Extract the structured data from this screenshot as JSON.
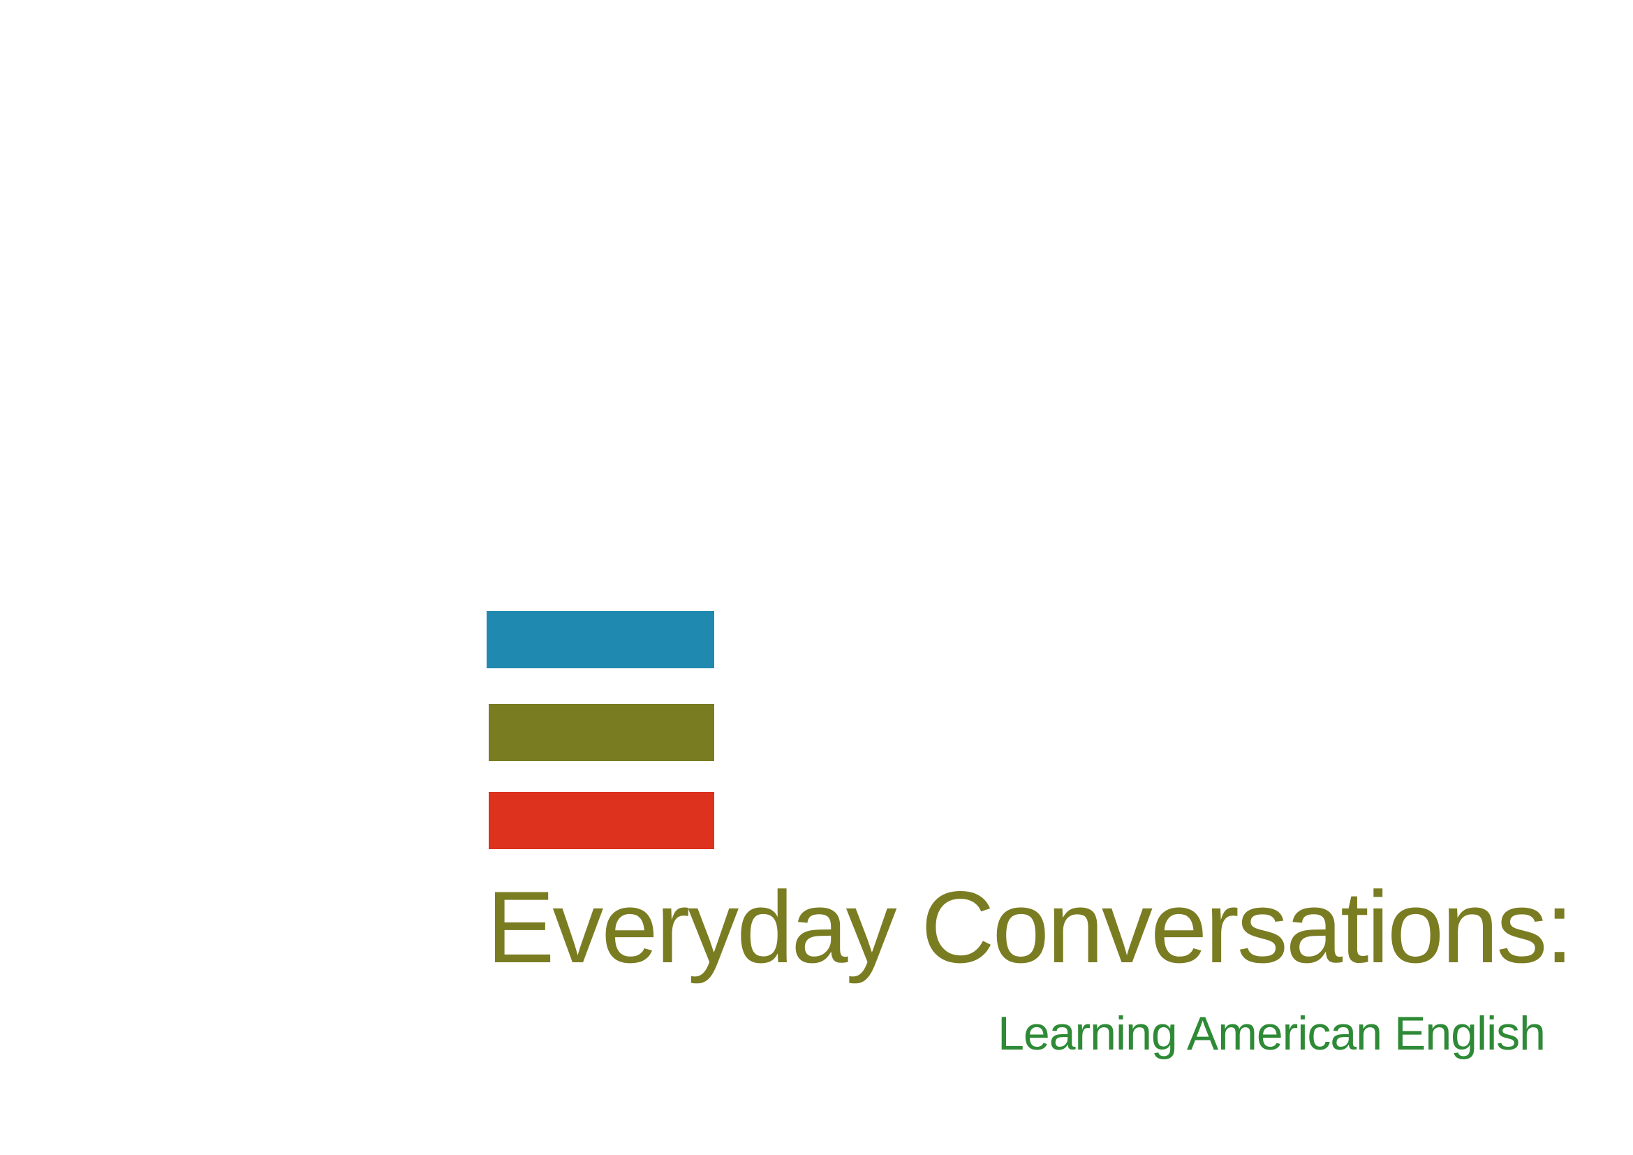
{
  "cover": {
    "title": "Everyday Conversations:",
    "subtitle": "Learning American English"
  },
  "colors": {
    "bar_blue": "#2089b0",
    "bar_olive": "#7a7c22",
    "bar_red": "#dc321e",
    "title_color": "#7a7c22",
    "subtitle_color": "#2e8a36",
    "background": "#ffffff"
  }
}
